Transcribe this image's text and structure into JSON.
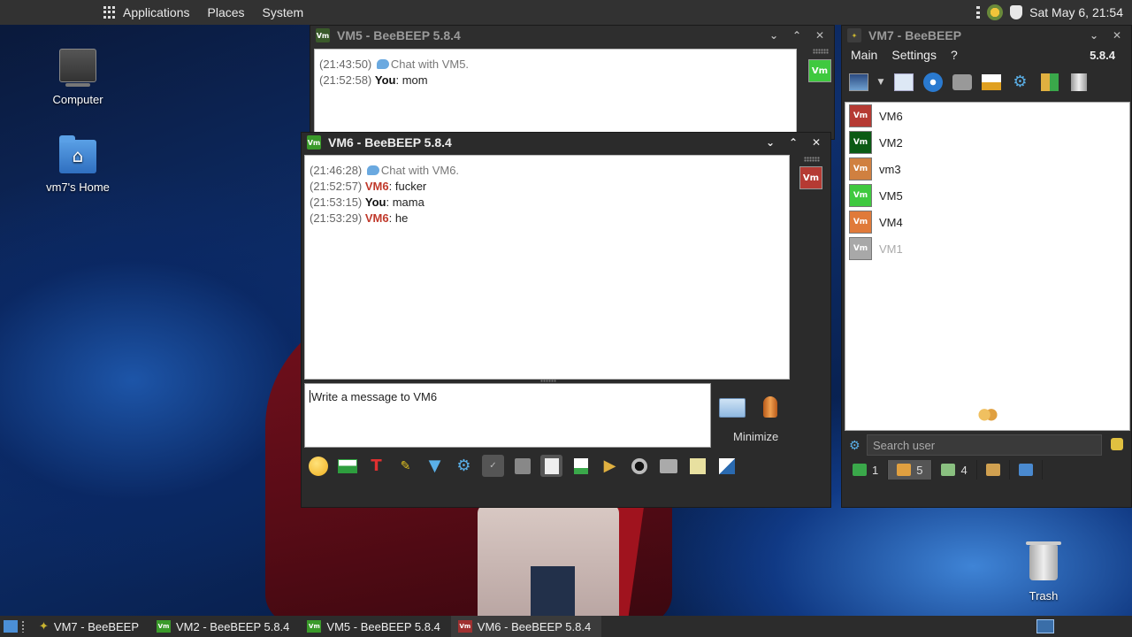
{
  "colors": {
    "vm6": "#c0392b",
    "vm2": "#0b6e1a",
    "vm3": "#e08a2f",
    "vm5": "#3fc93f",
    "vm4": "#e07a3a",
    "vm1": "#a8a8a8",
    "panel": "#323232"
  },
  "top_panel": {
    "applications": "Applications",
    "places": "Places",
    "system": "System",
    "clock": "Sat May  6, 21:54"
  },
  "desktop": {
    "computer": "Computer",
    "home": "vm7's Home",
    "trash": "Trash"
  },
  "vm5_window": {
    "title": "VM5 - BeeBEEP 5.8.4",
    "messages": [
      {
        "time": "(21:43:50)",
        "text": "Chat with VM5."
      },
      {
        "time": "(21:52:58)",
        "sender": "You",
        "text": ": mom"
      }
    ],
    "badge": "Vm"
  },
  "vm6_window": {
    "title": "VM6 - BeeBEEP 5.8.4",
    "badge": "Vm",
    "messages": [
      {
        "time": "(21:46:28)",
        "text": "Chat with VM6."
      },
      {
        "time": "(21:52:57)",
        "sender": "VM6",
        "text": ": fucker"
      },
      {
        "time": "(21:53:15)",
        "sender": "You",
        "text": ": mama"
      },
      {
        "time": "(21:53:29)",
        "sender": "VM6",
        "text": ": he"
      }
    ],
    "input_placeholder": "Write a message to VM6",
    "minimize": "Minimize"
  },
  "vm7_window": {
    "title": "VM7 - BeeBEEP",
    "version": "5.8.4",
    "menu": [
      "Main",
      "Settings",
      "?"
    ],
    "users": [
      {
        "name": "VM6",
        "badge": "Vm"
      },
      {
        "name": "VM2",
        "badge": "Vm"
      },
      {
        "name": "vm3",
        "badge": "Vm"
      },
      {
        "name": "VM5",
        "badge": "Vm"
      },
      {
        "name": "VM4",
        "badge": "Vm"
      },
      {
        "name": "VM1",
        "badge": "Vm"
      }
    ],
    "search_placeholder": "Search user",
    "tabs": [
      {
        "count": "1"
      },
      {
        "count": "5"
      },
      {
        "count": "4"
      }
    ]
  },
  "taskbar": {
    "items": [
      "VM7 - BeeBEEP",
      "VM2 - BeeBEEP 5.8.4",
      "VM5 - BeeBEEP 5.8.4",
      "VM6 - BeeBEEP 5.8.4"
    ],
    "badge": "Vm"
  }
}
